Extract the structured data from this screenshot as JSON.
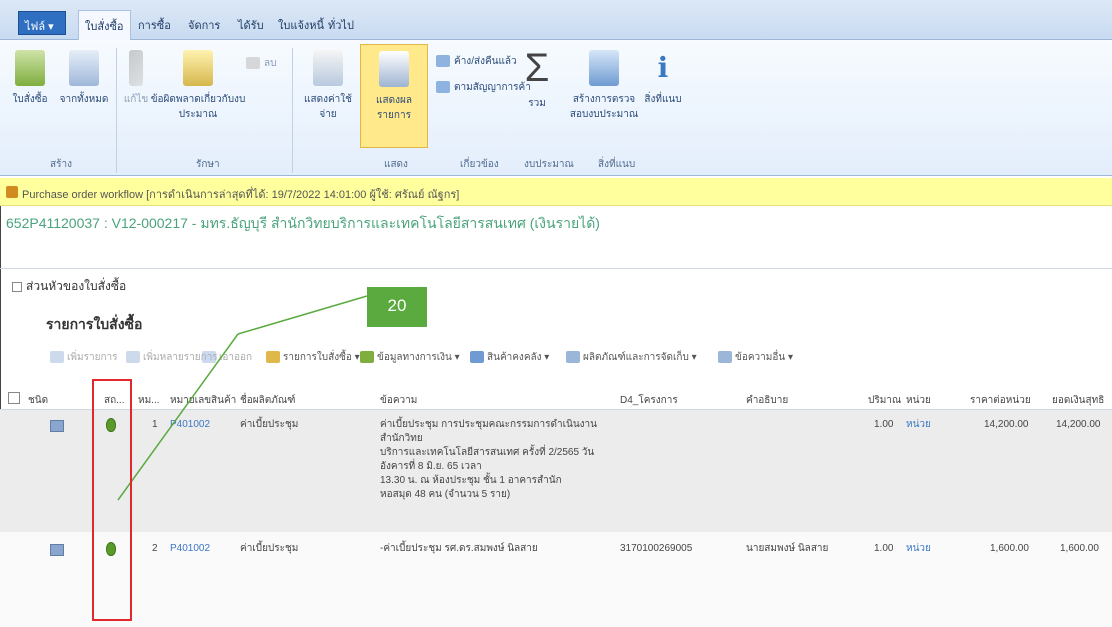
{
  "ribbon_tabs": {
    "file": "ไฟล์ ▾",
    "tabs": [
      "ใบสั่งซื้อ",
      "การซื้อ",
      "จัดการ",
      "ได้รับ",
      "ใบแจ้งหนี้",
      "ทั่วไป"
    ]
  },
  "ribbon": {
    "new_po": "ใบสั่งซื้อ",
    "from_all": "จากทั้งหมด",
    "edit": "แก้ไข",
    "edit_lines": "ข้อผิดพลาดเกี่ยวกับงบประมาณ",
    "delete": "ลบ",
    "maintain_charges": "แสดงค่าใช้จ่าย",
    "view_details": "แสดงผลรายการ",
    "small_1": "ค้าง/ส่งคืนแล้ว",
    "small_2": "ตามสัญญาการค้า",
    "totals": "รวม",
    "budget_check": "สร้างการตรวจสอบงบประมาณ",
    "attachments": "สิ่งที่แนบ",
    "group_new": "สร้าง",
    "group_maintain": "รักษา",
    "group_view": "แสดง",
    "group_related": "เกี่ยวข้อง",
    "group_budget": "งบประมาณ",
    "group_attachments": "สิ่งที่แนบ"
  },
  "notification": {
    "text": "Purchase order workflow [การดำเนินการล่าสุดที่ได้: 19/7/2022 14:01:00 ผู้ใช้: ศรัณย์ ณัฐกร]"
  },
  "page": {
    "title": "652P41120037 : V12-000217 - มทร.ธัญบุรี สำนักวิทยบริการและเทคโนโลยีสารสนเทศ (เงินรายได้)"
  },
  "section": {
    "header": "ส่วนหัวของใบสั่งซื้อ",
    "lines_title": "รายการใบสั่งซื้อ"
  },
  "grid_toolbar": {
    "add_line": "เพิ่มรายการ",
    "add_lines": "เพิ่มหลายรายการ",
    "remove": "เอาออก",
    "line_details": "รายการใบสั่งซื้อ ▾",
    "financials": "ข้อมูลทางการเงิน ▾",
    "inventory": "สินค้าคงคลัง ▾",
    "product": "ผลิตภัณฑ์และการจัดเก็บ ▾",
    "line_attach": "ข้อความอื่น ▾"
  },
  "grid_columns": [
    "ชนิด",
    "สถ...",
    "หม...",
    "หมายเลขสินค้า",
    "ชื่อผลิตภัณฑ์",
    "ข้อความ",
    "D4_โครงการ",
    "คำอธิบาย",
    "ปริมาณ",
    "หน่วย",
    "ราคาต่อหน่วย",
    "ยอดเงินสุทธิ"
  ],
  "rows": [
    {
      "line_no": "1",
      "item": "P401002",
      "product": "ค่าเบี้ยประชุม",
      "text_lines": [
        "ค่าเบี้ยประชุม การประชุมคณะกรรมการดำเนินงาน สำนักวิทย",
        "บริการและเทคโนโลยีสารสนเทศ ครั้งที่ 2/2565 วันอังคารที่ 8 มิ.ย. 65 เวลา",
        "13.30 น. ณ ห้องประชุม ชั้น 1 อาคารสำนัก",
        "หอสมุด 48 คน (จำนวน 5 ราย)"
      ],
      "project": "",
      "description": "",
      "quantity": "1.00",
      "unit": "หน่วย",
      "unit_price": "14,200.00",
      "net_amount": "14,200.00"
    },
    {
      "line_no": "2",
      "item": "P401002",
      "product": "ค่าเบี้ยประชุม",
      "text_lines": [
        "-ค่าเบี้ยประชุม รศ.ดร.สมพงษ์ นิลสาย"
      ],
      "project": "3170100269005",
      "description": "นายสมพงษ์ นิลสาย",
      "quantity": "1.00",
      "unit": "หน่วย",
      "unit_price": "1,600.00",
      "net_amount": "1,600.00"
    }
  ],
  "annotation": {
    "callout_number": "20"
  },
  "colors": {
    "accent_green": "#5aaa3f",
    "highlight_red": "#e0282f",
    "notify_yellow": "#ffff9e"
  }
}
